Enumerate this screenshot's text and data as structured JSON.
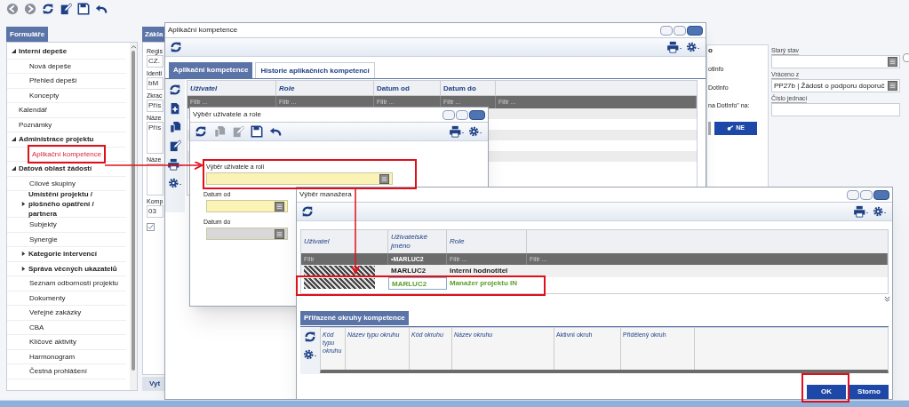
{
  "sidebar": {
    "tab": "Formuláře",
    "items": [
      {
        "label": "Interní depeše",
        "expanded": true,
        "selected": false,
        "children": [
          {
            "label": "Nová depeše",
            "selected": false
          },
          {
            "label": "Přehled depeší",
            "selected": false
          },
          {
            "label": "Koncepty",
            "selected": false
          }
        ]
      },
      {
        "label": "Kalendář",
        "selected": false
      },
      {
        "label": "Poznámky",
        "selected": false
      },
      {
        "label": "Administrace projektu",
        "expanded": true,
        "selected": false,
        "children": [
          {
            "label": "Aplikační kompetence",
            "selected": true
          }
        ]
      },
      {
        "label": "Datová oblast žádostí",
        "expanded": true,
        "selected": false,
        "children": [
          {
            "label": "Cílové skupiny",
            "selected": false
          },
          {
            "label": "Umístění projektu / plošného opatření / partnera",
            "expanded": false,
            "selected": false
          },
          {
            "label": "Subjekty",
            "selected": false
          },
          {
            "label": "Synergie",
            "selected": false
          },
          {
            "label": "Kategorie intervencí",
            "expanded": false,
            "selected": false
          },
          {
            "label": "Správa věcných ukazatelů",
            "expanded": false,
            "selected": false
          },
          {
            "label": "Seznam odborností projektu",
            "selected": false
          },
          {
            "label": "Dokumenty",
            "selected": false
          },
          {
            "label": "Veřejné zakázky",
            "selected": false
          },
          {
            "label": "CBA",
            "selected": false
          },
          {
            "label": "Klíčové aktivity",
            "selected": false
          },
          {
            "label": "Harmonogram",
            "selected": false
          },
          {
            "label": "Čestná prohlášení",
            "selected": false
          }
        ]
      }
    ]
  },
  "background_form": {
    "tab": "Zákla",
    "fields": [
      {
        "label": "Regis",
        "value": "CZ."
      },
      {
        "label": "Identi",
        "value": "bM"
      },
      {
        "label": "Zkrac",
        "value": "Přís"
      },
      {
        "label": "Náze",
        "value": "Přís"
      },
      {
        "label": "Náze"
      },
      {
        "label": "Komp",
        "value": "03"
      }
    ],
    "checkbox": {
      "checked": true
    },
    "footer_button": "Vyt"
  },
  "right_panel": {
    "heading": "o",
    "lines": [
      "otInfo",
      "DotInfo",
      "na DotInfo\" na:"
    ],
    "button": "NE",
    "fields": [
      {
        "label": "Starý stav"
      },
      {
        "label": "Vráceno z",
        "value": "PP27b | Žádost o podporu doporuč"
      },
      {
        "label": "Číslo jednací"
      }
    ],
    "checkbox": {
      "checked": false
    }
  },
  "window_competence": {
    "title": "Aplikační kompetence",
    "tabs": [
      {
        "label": "Aplikační kompetence",
        "selected": true
      },
      {
        "label": "Historie aplikačních kompetencí",
        "selected": false
      }
    ],
    "columns": [
      "Uživatel",
      "Role",
      "Datum od",
      "Datum do"
    ],
    "filter_row": [
      "Filtr ...",
      "Filtr ...",
      "Filtr ...",
      "Filtr ...",
      "Filtr ..."
    ]
  },
  "window_user_role": {
    "title": "Výběr uživatele a role",
    "fields": [
      {
        "label": "Výběr uživatele a roli",
        "kind": "picker",
        "required": true
      },
      {
        "label": "Datum od",
        "kind": "date",
        "required": true
      },
      {
        "label": "Datum do",
        "kind": "date",
        "required": false
      }
    ]
  },
  "window_manager": {
    "title": "Výběr manažera",
    "columns": [
      "Uživatel",
      "Uživatelské jméno",
      "Role"
    ],
    "filter_row": [
      "Filtr",
      "•MARLUC2",
      "Filtr ...",
      "Filtr ..."
    ],
    "rows": [
      {
        "username": "MARLUC2",
        "role": "Interní hodnotitel",
        "selected": false
      },
      {
        "username": "MARLUC2",
        "role": "Manažer projektu IN",
        "selected": true
      }
    ],
    "section_tab": "Přiřazené okruhy kompetence",
    "section_columns": [
      "Kód typu okruhu",
      "Název typu okruhu",
      "Kód okruhu",
      "Název okruhu",
      "Aktivní okruh",
      "Přidělený okruh"
    ],
    "buttons": [
      "OK",
      "Storno"
    ]
  }
}
